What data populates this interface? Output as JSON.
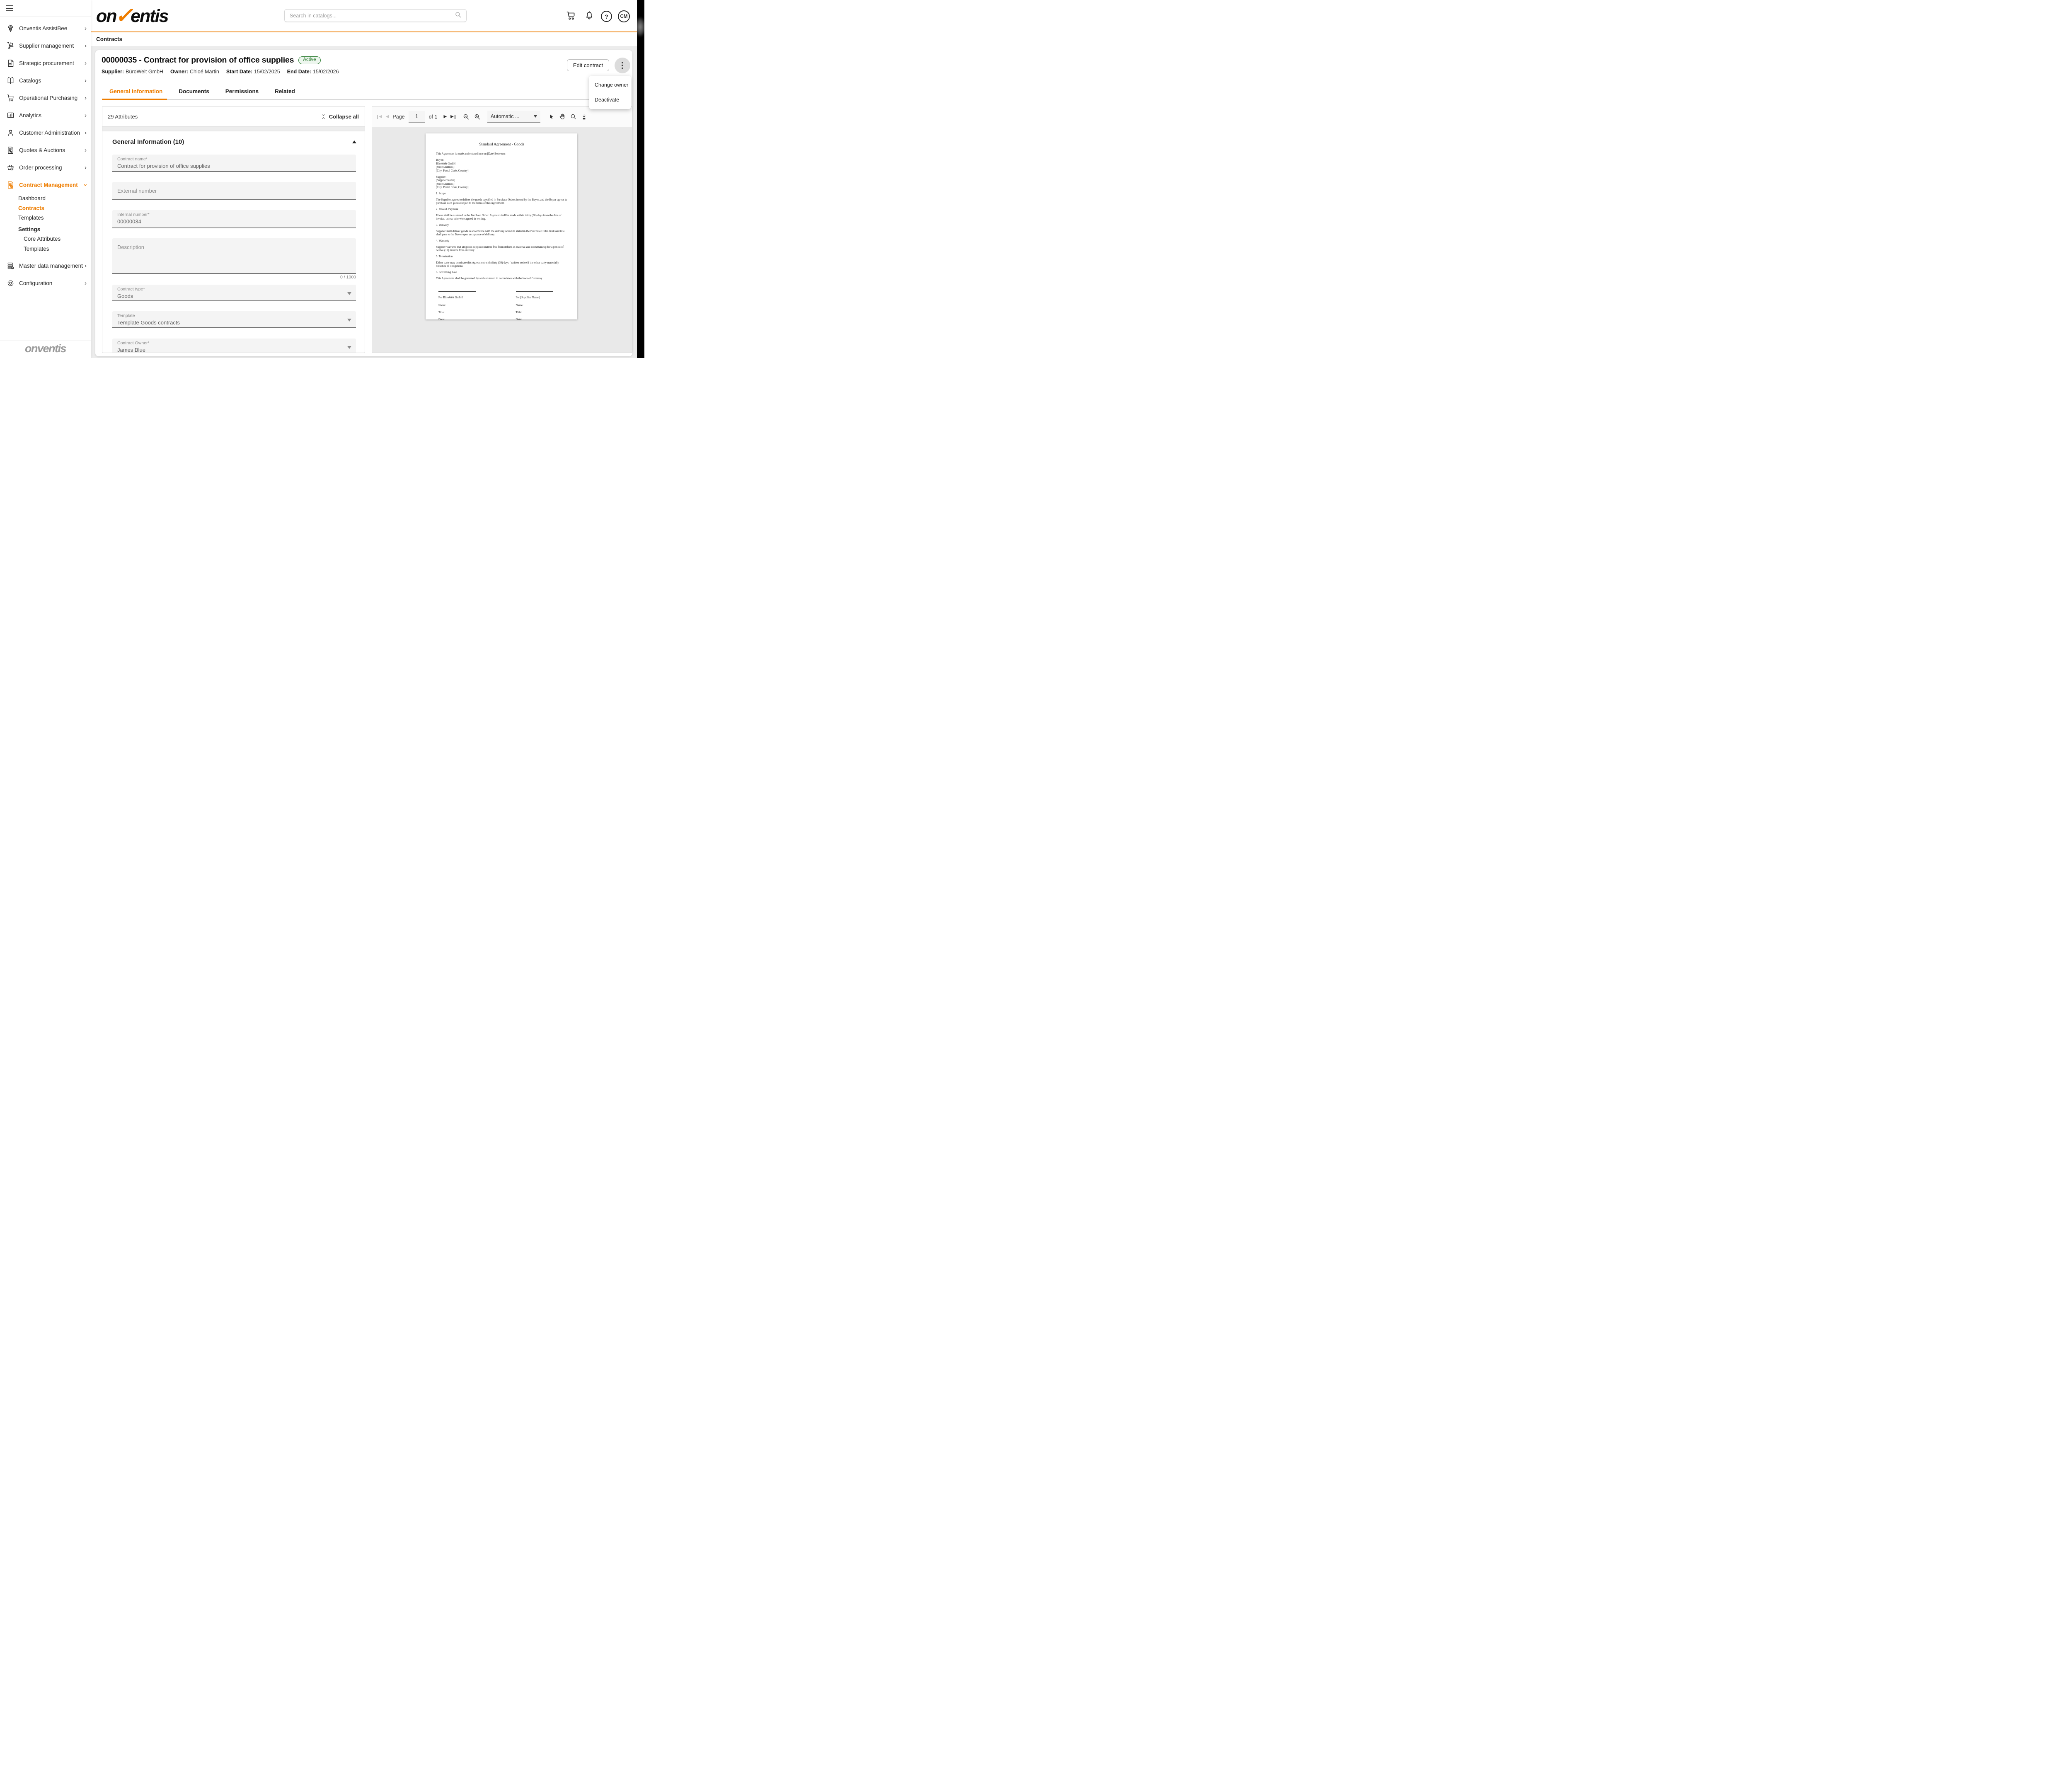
{
  "accent_color": "#ee7d00",
  "status_green": "#2e7d32",
  "header": {
    "logo": {
      "pre": "on",
      "check": "✓",
      "post": "entis"
    },
    "search_placeholder": "Search in catalogs...",
    "help_glyph": "?",
    "avatar": "CM"
  },
  "breadcrumb": "Contracts",
  "sidebar": {
    "items": [
      {
        "label": "Onventis AssistBee",
        "icon": "bee-icon"
      },
      {
        "label": "Supplier management",
        "icon": "hand-truck-icon"
      },
      {
        "label": "Strategic procurement",
        "icon": "handshake-document-icon"
      },
      {
        "label": "Catalogs",
        "icon": "book-icon"
      },
      {
        "label": "Operational Purchasing",
        "icon": "cart-icon"
      },
      {
        "label": "Analytics",
        "icon": "bar-chart-icon"
      },
      {
        "label": "Customer Administration",
        "icon": "person-icon"
      },
      {
        "label": "Quotes & Auctions",
        "icon": "document-percent-icon"
      },
      {
        "label": "Order processing",
        "icon": "basket-clock-icon"
      },
      {
        "label": "Contract Management",
        "icon": "contract-paragraph-icon",
        "active": true,
        "expanded": true
      }
    ],
    "contract_children": [
      {
        "label": "Dashboard"
      },
      {
        "label": "Contracts",
        "active": true
      },
      {
        "label": "Templates"
      },
      {
        "label": "Settings",
        "heading": true
      },
      {
        "label": "Core Attributes",
        "indent": true
      },
      {
        "label": "Templates",
        "indent": true
      }
    ],
    "bottom_items": [
      {
        "label": "Master data management",
        "icon": "master-data-icon"
      },
      {
        "label": "Configuration",
        "icon": "gear-icon"
      }
    ],
    "footer_logo": "onventis"
  },
  "contract": {
    "title": "00000035 - Contract for provision of office supplies",
    "status_badge": "Active",
    "meta": [
      {
        "label": "Supplier:",
        "value": "BüroWelt GmbH"
      },
      {
        "label": "Owner:",
        "value": "Chloé Martin"
      },
      {
        "label": "Start Date:",
        "value": "15/02/2025"
      },
      {
        "label": "End Date:",
        "value": "15/02/2026"
      }
    ],
    "edit_button": "Edit contract",
    "menu": [
      "Change owner",
      "Deactivate"
    ]
  },
  "tabs": [
    {
      "label": "General Information",
      "active": true
    },
    {
      "label": "Documents"
    },
    {
      "label": "Permissions"
    },
    {
      "label": "Related"
    }
  ],
  "attributes": {
    "header": "29 Attributes",
    "collapse_all": "Collapse all",
    "section_title": "General Information (10)",
    "fields": [
      {
        "label": "Contract name*",
        "value": "Contract for provision of office supplies"
      },
      {
        "label": "External number",
        "value": ""
      },
      {
        "label": "Internal number*",
        "value": "00000034"
      },
      {
        "label": "Description",
        "value": "",
        "counter": "0 / 1000"
      },
      {
        "label": "Contract type*",
        "value": "Goods"
      },
      {
        "label": "Template",
        "value": "Template Goods contracts"
      },
      {
        "label": "Contract Owner*",
        "value": "James Blue"
      }
    ]
  },
  "pdf": {
    "toolbar": {
      "page_label": "Page",
      "page_value": "1",
      "page_count": "of 1",
      "zoom_select": "Automatic ..."
    },
    "document": {
      "title": "Standard Agreement - Goods",
      "intro": "This Agreement is made and entered into on [Date] between:",
      "buyer_label": "Buyer:",
      "buyer_lines": [
        "BüroWelt GmbH",
        "[Street Address]",
        "[City, Postal Code, Country]"
      ],
      "supplier_label": "Supplier:",
      "supplier_lines": [
        "[Supplier Name]",
        "[Street Address]",
        "[City, Postal Code, Country]"
      ],
      "sections": [
        {
          "heading": "1. Scope",
          "text": "The Supplier agrees to deliver the goods specified in Purchase Orders issued by the Buyer, and the Buyer agrees to purchase such goods subject to the terms of this Agreement."
        },
        {
          "heading": "2. Price & Payment",
          "text": "Prices shall be as stated in the Purchase Order. Payment shall be made within thirty (30) days from the date of invoice, unless otherwise agreed in writing."
        },
        {
          "heading": "3. Delivery",
          "text": "Supplier shall deliver goods in accordance with the delivery schedule stated in the Purchase Order. Risk and title shall pass to the Buyer upon acceptance of delivery."
        },
        {
          "heading": "4. Warranty",
          "text": "Supplier warrants that all goods supplied shall be free from defects in material and workmanship for a period of twelve (12) months from delivery."
        },
        {
          "heading": "5. Termination",
          "text": "Either party may terminate this Agreement with thirty (30) days ’ written notice if the other party materially breaches its obligations."
        },
        {
          "heading": "6. Governing Law",
          "text": "This Agreement shall be governed by and construed in accordance with the laws of Germany."
        }
      ],
      "signature": {
        "left_for": "For BüroWelt GmbH",
        "right_for": "For [Supplier Name]",
        "name_label": "Name:",
        "title_label": "Title:",
        "date_label": "Date:"
      }
    }
  }
}
